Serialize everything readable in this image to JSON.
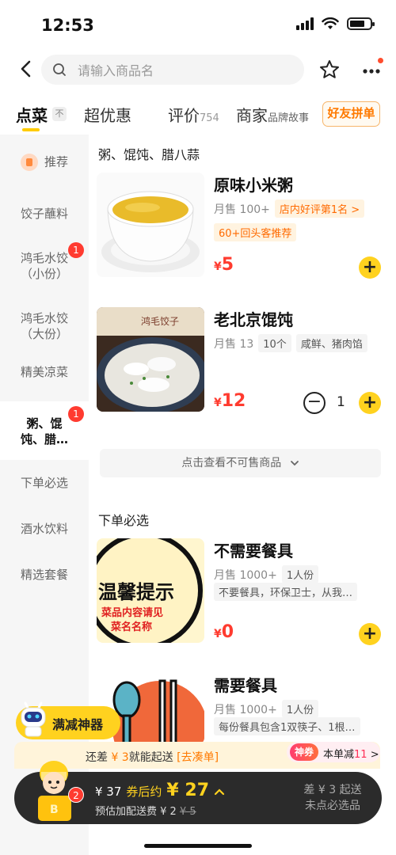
{
  "status": {
    "time": "12:53"
  },
  "search": {
    "placeholder": "请输入商品名"
  },
  "tabs": [
    {
      "label": "点菜",
      "badge": "不"
    },
    {
      "label": "超优惠"
    },
    {
      "label": "评价",
      "count": "754"
    },
    {
      "label": "商家",
      "sub": "品牌故事"
    }
  ],
  "group_button": "好友拼单",
  "sidebar": [
    {
      "label": "推荐"
    },
    {
      "label": "饺子蘸料"
    },
    {
      "label_line1": "鸿毛水饺",
      "label_line2": "（小份）",
      "badge": "1"
    },
    {
      "label_line1": "鸿毛水饺",
      "label_line2": "（大份）"
    },
    {
      "label": "精美凉菜"
    },
    {
      "label_line1": "粥、馄",
      "label_line2": "饨、腊…",
      "badge": "1"
    },
    {
      "label": "下单必选"
    },
    {
      "label": "酒水饮料"
    },
    {
      "label": "精选套餐"
    }
  ],
  "sections": [
    {
      "title": "粥、馄饨、腊八蒜"
    },
    {
      "title": "下单必选"
    }
  ],
  "products": [
    {
      "name": "原味小米粥",
      "sales": "月售 100+",
      "tag": "店内好评第1名 >",
      "tag2": "60+回头客推荐",
      "currency": "¥",
      "price": "5",
      "add": "+"
    },
    {
      "name": "老北京馄饨",
      "sales": "月售 13",
      "tags": [
        "10个",
        "咸鲜、猪肉馅"
      ],
      "image_text": "鸿毛饺子",
      "currency": "¥",
      "price": "12",
      "minus": "−",
      "qty": "1",
      "add": "+"
    },
    {
      "name": "不需要餐具",
      "sales": "月售 1000+",
      "tags": [
        "1人份"
      ],
      "tag2": "不要餐具，环保卫士，从我…",
      "image_text_1": "温馨提示",
      "image_text_2": "菜品内容请见",
      "image_text_3": "菜名名称",
      "currency": "¥",
      "price": "0",
      "add": "+"
    },
    {
      "name": "需要餐具",
      "sales": "月售 1000+",
      "tags": [
        "1人份"
      ],
      "tag2": "每份餐具包含1双筷子、1根…"
    }
  ],
  "unavailable": "点击查看不可售商品",
  "promo": {
    "label": "满减神器"
  },
  "tip": {
    "prefix": "还差",
    "amount": " ¥ 3",
    "mid": "就能起送",
    "link": "[去凑单]"
  },
  "shenquan": {
    "tag": "神券",
    "text": "本单减",
    "amount": "11",
    "arrow": ">"
  },
  "cart": {
    "count": "2",
    "total": "¥ 37",
    "after_label": "券后约",
    "after_price": "¥ 27",
    "delivery_label": "预估加配送费 ¥ 2",
    "delivery_original": "¥ 5",
    "right_line1": "差 ¥ 3 起送",
    "right_line2": "未点必选品"
  },
  "colors": {
    "accent": "#ffd21f",
    "price": "#ff3b2f",
    "badge": "#ff3b30"
  }
}
